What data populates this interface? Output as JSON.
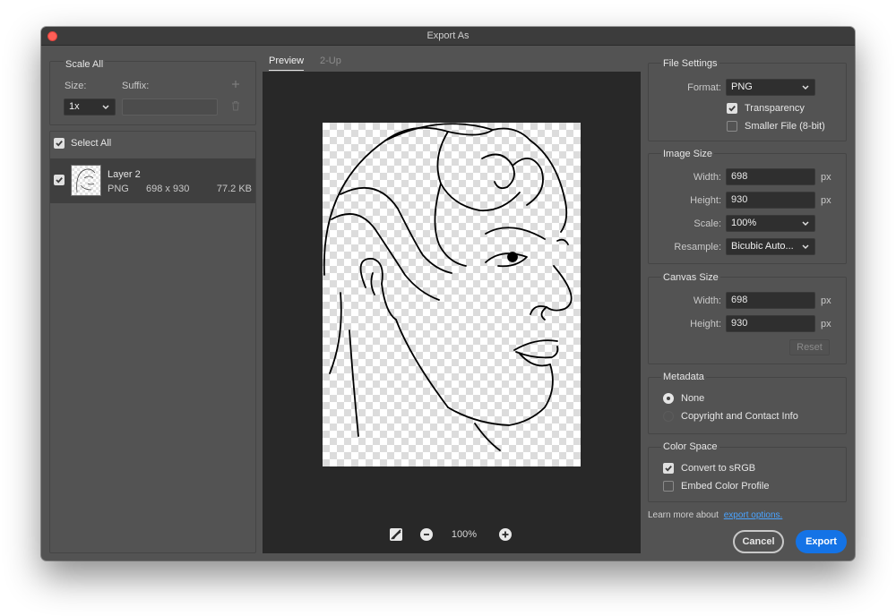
{
  "window": {
    "title": "Export As"
  },
  "scale_all": {
    "heading": "Scale All",
    "size_label": "Size:",
    "suffix_label": "Suffix:",
    "size_value": "1x",
    "suffix_value": "",
    "add_icon": "plus-icon",
    "delete_icon": "trash-icon"
  },
  "layers": {
    "select_all_label": "Select All",
    "select_all_checked": true,
    "items": [
      {
        "name": "Layer 2",
        "format": "PNG",
        "dimensions": "698 x 930",
        "size": "77.2 KB",
        "checked": true
      }
    ]
  },
  "preview": {
    "tabs": [
      {
        "label": "Preview",
        "active": true
      },
      {
        "label": "2-Up",
        "active": false
      }
    ],
    "zoom": "100%",
    "toggle_bg_icon": "canvas-background-icon",
    "zoom_out_icon": "minus-circle-icon",
    "zoom_in_icon": "plus-circle-icon"
  },
  "file_settings": {
    "heading": "File Settings",
    "format_label": "Format:",
    "format_value": "PNG",
    "transparency_label": "Transparency",
    "transparency_checked": true,
    "smaller_file_label": "Smaller File (8-bit)",
    "smaller_file_checked": false
  },
  "image_size": {
    "heading": "Image Size",
    "width_label": "Width:",
    "width_value": "698",
    "height_label": "Height:",
    "height_value": "930",
    "scale_label": "Scale:",
    "scale_value": "100%",
    "resample_label": "Resample:",
    "resample_value": "Bicubic Auto...",
    "unit": "px"
  },
  "canvas_size": {
    "heading": "Canvas Size",
    "width_label": "Width:",
    "width_value": "698",
    "height_label": "Height:",
    "height_value": "930",
    "unit": "px",
    "reset_label": "Reset"
  },
  "metadata": {
    "heading": "Metadata",
    "options": [
      {
        "label": "None",
        "selected": true
      },
      {
        "label": "Copyright and Contact Info",
        "selected": false
      }
    ]
  },
  "color_space": {
    "heading": "Color Space",
    "convert_label": "Convert to sRGB",
    "convert_checked": true,
    "embed_label": "Embed Color Profile",
    "embed_checked": false
  },
  "footer": {
    "learn_more_text": "Learn more about",
    "learn_more_link": "export options.",
    "cancel_label": "Cancel",
    "export_label": "Export"
  },
  "colors": {
    "window_bg": "#535353",
    "panel_bg": "#4a4a4a",
    "preview_bg": "#282828",
    "accent": "#1473e6",
    "link": "#4aa3ff"
  }
}
